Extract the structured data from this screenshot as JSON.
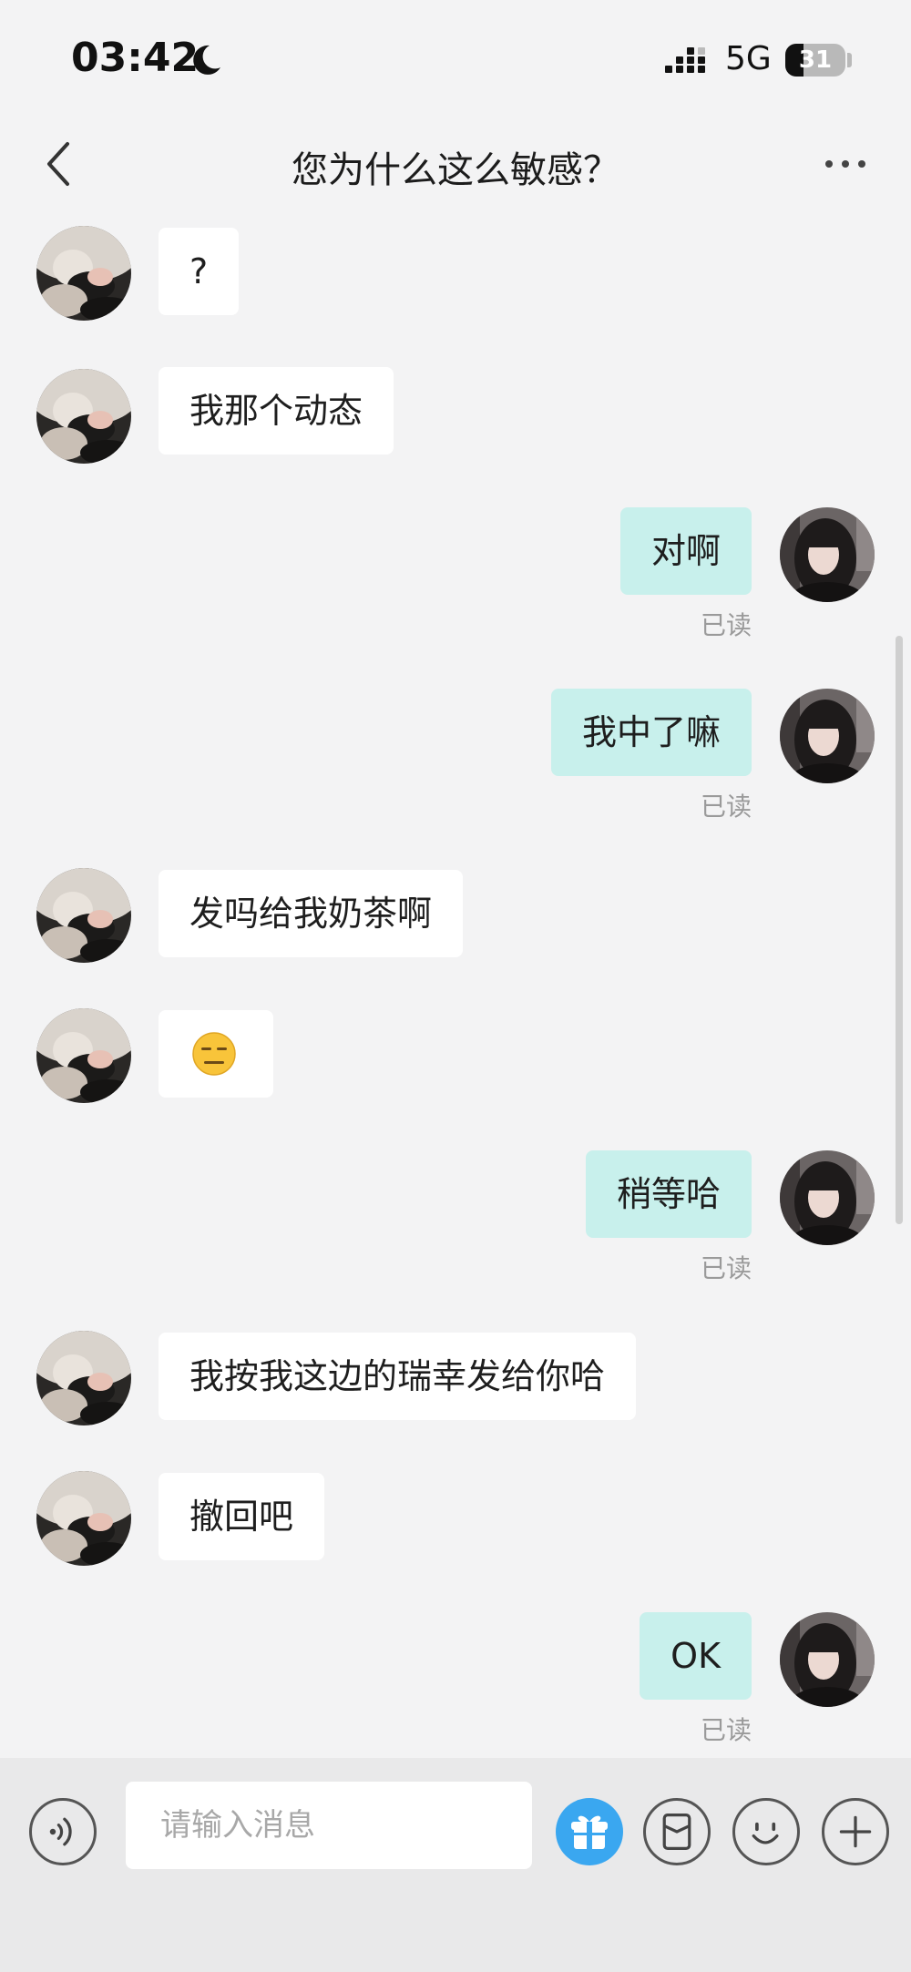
{
  "status_bar": {
    "time": "03:42",
    "network": "5G",
    "battery_level": "31"
  },
  "header": {
    "title": "您为什么这么敏感？"
  },
  "messages": [
    {
      "side": "in",
      "text": "?",
      "icon": "contact-avatar"
    },
    {
      "side": "in",
      "text": "我那个动态",
      "icon": "contact-avatar"
    },
    {
      "side": "out",
      "text": "对啊",
      "status": "已读",
      "icon": "self-avatar"
    },
    {
      "side": "out",
      "text": "我中了嘛",
      "status": "已读",
      "icon": "self-avatar"
    },
    {
      "side": "in",
      "text": "发吗给我奶茶啊",
      "icon": "contact-avatar"
    },
    {
      "side": "in",
      "emoji": "expressionless-face-emoji",
      "icon": "contact-avatar"
    },
    {
      "side": "out",
      "text": "稍等哈",
      "status": "已读",
      "icon": "self-avatar"
    },
    {
      "side": "in",
      "text": "我按我这边的瑞幸发给你哈",
      "icon": "contact-avatar"
    },
    {
      "side": "in",
      "text": "撤回吧",
      "icon": "contact-avatar"
    },
    {
      "side": "out",
      "text": "OK",
      "status": "已读",
      "icon": "self-avatar"
    }
  ],
  "input_bar": {
    "placeholder": "请输入消息",
    "icons": [
      "voice-icon",
      "gift-icon",
      "envelope-icon",
      "emoji-icon",
      "plus-icon"
    ],
    "gift_color": "#3aa7f0"
  },
  "colors": {
    "incoming_bubble": "#ffffff",
    "outgoing_bubble": "#c8f0ec",
    "background": "#f3f3f4"
  }
}
